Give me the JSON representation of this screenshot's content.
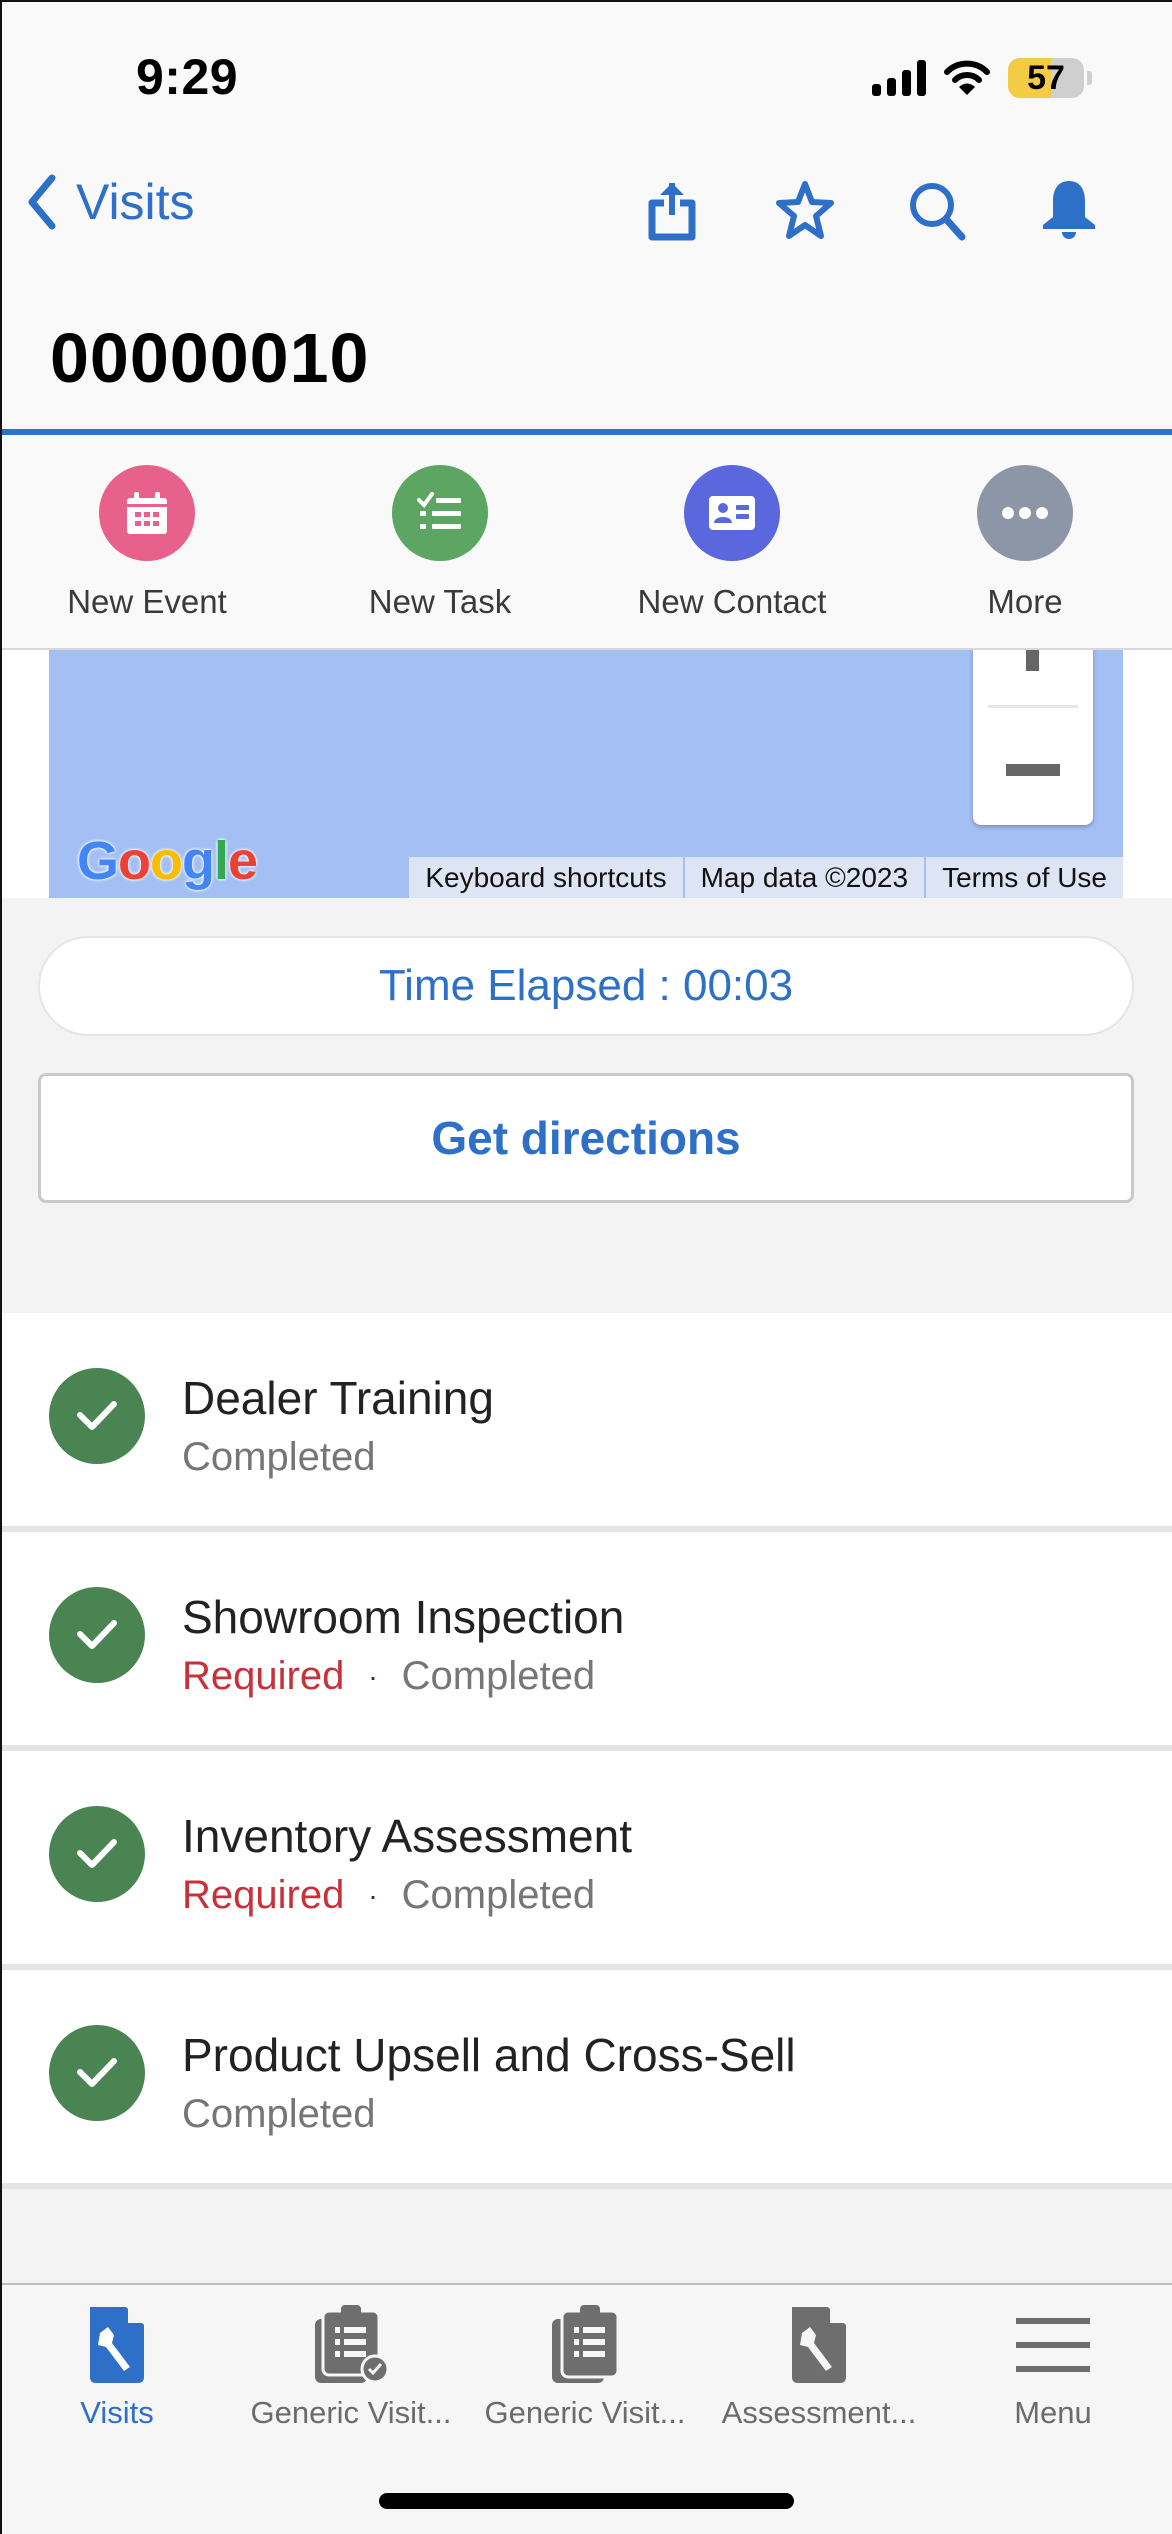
{
  "status_bar": {
    "time": "9:29",
    "battery_percent": "57",
    "battery_level": 0.57,
    "low_power_mode": true
  },
  "header": {
    "back_label": "Visits",
    "icons": [
      "share-icon",
      "star-icon",
      "search-icon",
      "bell-icon"
    ],
    "record_title": "00000010",
    "accent_color": "#2e6fc7"
  },
  "actions": [
    {
      "label": "New Event",
      "icon": "calendar-icon",
      "color": "#e8608c"
    },
    {
      "label": "New Task",
      "icon": "task-list-icon",
      "color": "#5ca562"
    },
    {
      "label": "New Contact",
      "icon": "contact-card-icon",
      "color": "#5b68dd"
    },
    {
      "label": "More",
      "icon": "more-dots-icon",
      "color": "#8c96a6"
    }
  ],
  "map": {
    "logo": "Google",
    "attribution": [
      "Keyboard shortcuts",
      "Map data ©2023",
      "Terms of Use"
    ]
  },
  "timer": {
    "text": "Time Elapsed : 00:03"
  },
  "directions": {
    "label": "Get directions"
  },
  "tasks": [
    {
      "title": "Dealer Training",
      "required": "",
      "status": "Completed"
    },
    {
      "title": "Showroom Inspection",
      "required": "Required",
      "separator": "·",
      "status": "Completed"
    },
    {
      "title": "Inventory Assessment",
      "required": "Required",
      "separator": "·",
      "status": "Completed"
    },
    {
      "title": "Product Upsell and Cross-Sell",
      "required": "",
      "status": "Completed"
    }
  ],
  "tabbar": {
    "tabs": [
      {
        "label": "Visits",
        "icon": "wrench-doc-icon",
        "active": true
      },
      {
        "label": "Generic Visit...",
        "icon": "clipboard-check-icon",
        "active": false
      },
      {
        "label": "Generic Visit...",
        "icon": "clipboard-list-icon",
        "active": false
      },
      {
        "label": "Assessment...",
        "icon": "wrench-doc-icon",
        "active": false
      },
      {
        "label": "Menu",
        "icon": "hamburger-menu-icon",
        "active": false
      }
    ]
  }
}
